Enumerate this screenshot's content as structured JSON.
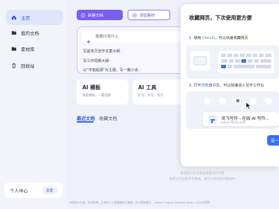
{
  "sidebar": {
    "items": [
      {
        "label": "主页",
        "icon": "home-icon"
      },
      {
        "label": "我的文档",
        "icon": "folder-icon"
      },
      {
        "label": "素材库",
        "icon": "folder-icon"
      },
      {
        "label": "回收站",
        "icon": "trash-icon"
      }
    ],
    "user": {
      "label": "个人中心",
      "login": "去登"
    }
  },
  "toolbar": {
    "new_doc": "新建文档",
    "add_material": "添加素材"
  },
  "ai_box": {
    "placeholder": "輸要问我什么",
    "prompts": [
      "写篮克贝宣作文案大纲 ·",
      "写工作周报大纲 ·",
      "以\"宇宙起源\"为主题，写一篇小说 ·"
    ]
  },
  "cards": [
    {
      "title": "AI 模板",
      "sub": "快套模板，一键话题"
    },
    {
      "title": "AI 工具",
      "sub": "扩写、改写、仿写"
    }
  ],
  "tabs": {
    "recent": "最近文档",
    "favorites": "收藏文档"
  },
  "empty": {
    "line1": "登录后以在设备查看最近的文档",
    "line2": "您可以在设备并无数据，您可以添加到的数据中"
  },
  "footer": "内容由AI生成，仅供参考，生成式人工智能服务已备案 | 京公网安备号，Isidale Graphic DesExtel Kedly LiCENE等明",
  "popup": {
    "title": "收藏网页，下次使用更方便",
    "step1": {
      "num": "1.",
      "pre": "使用 ",
      "keys": "Ctrl+D",
      "post": "，可以快速收藏网页"
    },
    "step2": {
      "num": "2.",
      "pre": "打开",
      "link": "浏览器书签",
      "post": "，可以快速进入写作工作台"
    },
    "bookmark_title": "讯飞写作 - 在线 AI 写作...",
    "bookmark_url": "huixie.iflyrec.com",
    "button": "设一设"
  },
  "colors": {
    "accent": "#3a5bd9",
    "purple": "#7a5ef0",
    "background": "#eef1f8"
  }
}
